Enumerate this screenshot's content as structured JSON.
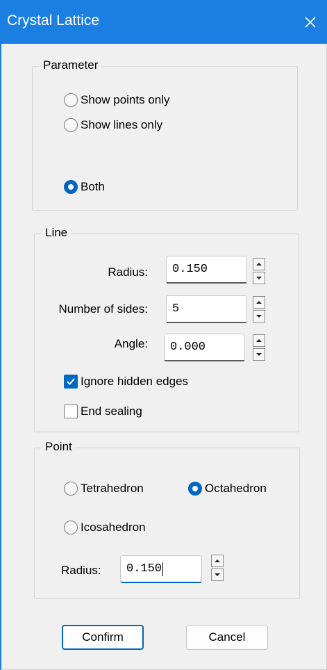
{
  "window": {
    "title": "Crystal Lattice"
  },
  "parameter": {
    "legend": "Parameter",
    "options": [
      {
        "label": "Show points only",
        "checked": false
      },
      {
        "label": "Show lines only",
        "checked": false
      },
      {
        "label": "Both",
        "checked": true
      }
    ]
  },
  "line": {
    "legend": "Line",
    "radius": {
      "label": "Radius:",
      "value": "0.150"
    },
    "sides": {
      "label": "Number of sides:",
      "value": "5"
    },
    "angle": {
      "label": "Angle:",
      "value": "0.000"
    },
    "ignore_hidden": {
      "label": "Ignore hidden edges",
      "checked": true
    },
    "end_sealing": {
      "label": "End sealing",
      "checked": false
    }
  },
  "point": {
    "legend": "Point",
    "tetrahedron": {
      "label": "Tetrahedron",
      "checked": false
    },
    "octahedron": {
      "label": "Octahedron",
      "checked": true
    },
    "icosahedron": {
      "label": "Icosahedron",
      "checked": false
    },
    "radius": {
      "label": "Radius:",
      "value": "0.150"
    }
  },
  "buttons": {
    "confirm": "Confirm",
    "cancel": "Cancel"
  },
  "colors": {
    "titlebar": "#1a7fe0",
    "accent": "#0067c0",
    "background": "#f0f0f0"
  }
}
